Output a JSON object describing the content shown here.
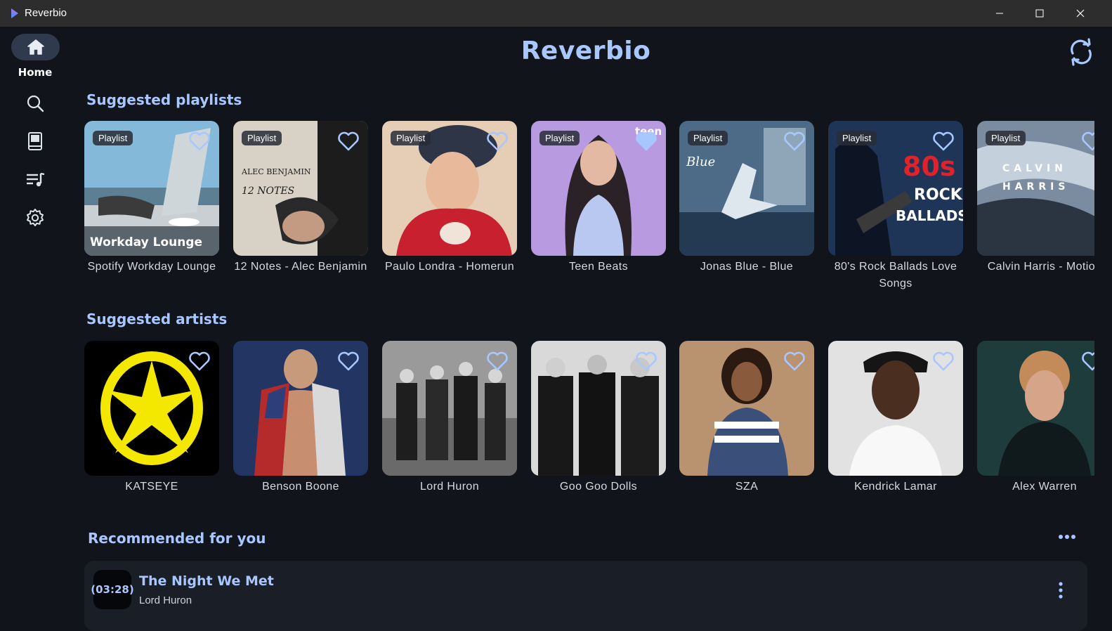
{
  "window": {
    "title": "Reverbio",
    "controls": [
      "minimize",
      "maximize",
      "close"
    ]
  },
  "sidebar": {
    "items": [
      {
        "label": "Home",
        "icon": "home-icon",
        "active": true
      },
      {
        "label": "",
        "icon": "search-icon"
      },
      {
        "label": "",
        "icon": "library-icon"
      },
      {
        "label": "",
        "icon": "queue-music-icon"
      },
      {
        "label": "",
        "icon": "settings-icon"
      }
    ]
  },
  "header": {
    "title": "Reverbio",
    "refresh_icon": "refresh-icon"
  },
  "sections": {
    "playlists": {
      "title": "Suggested playlists",
      "badge": "Playlist",
      "items": [
        {
          "name": "Spotify Workday Lounge",
          "art_text": "Workday Lounge",
          "colors": [
            "#7ab4d8",
            "#2f4a5c"
          ]
        },
        {
          "name": "12 Notes - Alec Benjamin",
          "art_text": "ALEC BENJAMIN",
          "colors": [
            "#d8d2c6",
            "#1a1a1a"
          ]
        },
        {
          "name": "Paulo Londra - Homerun",
          "art_text": "",
          "colors": [
            "#e6cdb5",
            "#c8202e"
          ]
        },
        {
          "name": "Teen Beats",
          "art_text": "teen beats",
          "colors": [
            "#b79ae0",
            "#2a2226"
          ]
        },
        {
          "name": "Jonas Blue - Blue",
          "art_text": "Blue",
          "colors": [
            "#6f8fa8",
            "#1f3b55"
          ]
        },
        {
          "name": "80's Rock Ballads Love Songs",
          "art_text_1": "80s",
          "art_text_2": "ROCK BALLADS",
          "colors": [
            "#2c4a78",
            "#0e1a2e"
          ]
        },
        {
          "name": "Calvin Harris - Motion",
          "art_text": "C A L V I N  H A R R I S",
          "colors": [
            "#a7b4c4",
            "#2b3441"
          ]
        }
      ]
    },
    "artists": {
      "title": "Suggested artists",
      "items": [
        {
          "name": "KATSEYE",
          "colors": [
            "#000000",
            "#f5e800"
          ]
        },
        {
          "name": "Benson Boone",
          "colors": [
            "#2a3a6a",
            "#b52a2a"
          ]
        },
        {
          "name": "Lord Huron",
          "colors": [
            "#8c8c8c",
            "#1e1e1e"
          ]
        },
        {
          "name": "Goo Goo Dolls",
          "colors": [
            "#d9d9d9",
            "#151515"
          ]
        },
        {
          "name": "SZA",
          "colors": [
            "#b98c6c",
            "#3a4f7a"
          ]
        },
        {
          "name": "Kendrick Lamar",
          "colors": [
            "#e5e5e5",
            "#1a1a1a"
          ]
        },
        {
          "name": "Alex Warren",
          "colors": [
            "#1f3c3c",
            "#caa07a"
          ]
        }
      ]
    },
    "recommended": {
      "title": "Recommended for you",
      "more_icon": "more-horizontal-icon",
      "songs": [
        {
          "title": "The Night We Met",
          "artist": "Lord Huron",
          "duration": "(03:28)"
        }
      ]
    }
  },
  "accent_color": "#a9c7ff"
}
